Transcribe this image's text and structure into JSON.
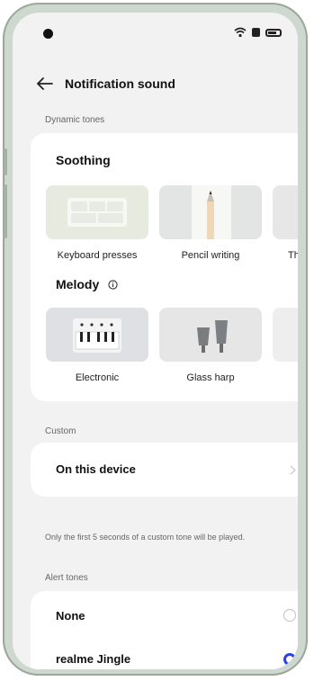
{
  "header": {
    "title": "Notification sound"
  },
  "dynamic_tones": {
    "section_label": "Dynamic tones",
    "soothing": {
      "title": "Soothing",
      "items": [
        {
          "label": "Keyboard presses"
        },
        {
          "label": "Pencil writing"
        },
        {
          "label": "Th"
        }
      ]
    },
    "melody": {
      "title": "Melody",
      "items": [
        {
          "label": "Electronic"
        },
        {
          "label": "Glass harp"
        }
      ]
    }
  },
  "custom": {
    "section_label": "Custom",
    "item_label": "On this device",
    "note": "Only the first 5 seconds of a custom tone will be played."
  },
  "alert_tones": {
    "section_label": "Alert tones",
    "items": [
      {
        "label": "None",
        "selected": false
      },
      {
        "label": "realme Jingle",
        "selected": true
      }
    ]
  },
  "colors": {
    "accent": "#2743e6",
    "background": "#f2f2f2"
  }
}
